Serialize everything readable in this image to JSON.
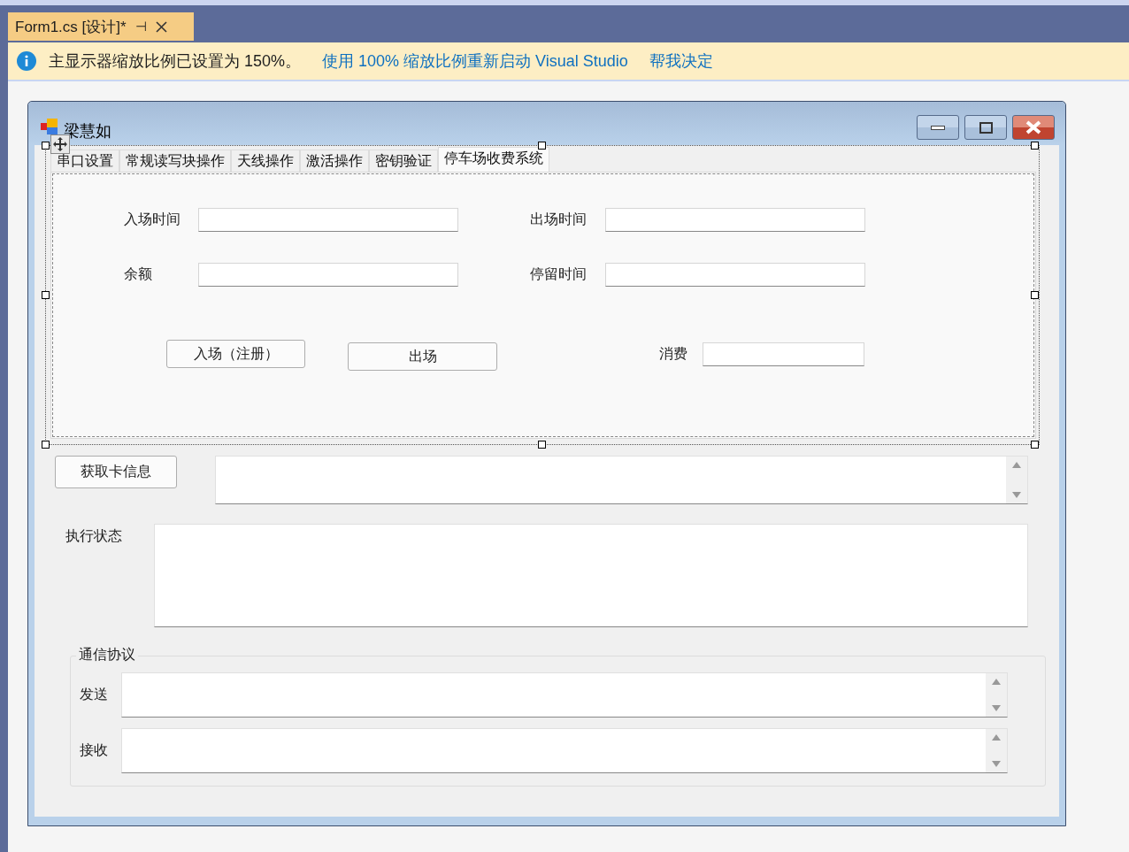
{
  "document_tab": {
    "title": "Form1.cs [设计]*",
    "pin": "⊣",
    "selected": true
  },
  "info_bar": {
    "message": "主显示器缩放比例已设置为 150%。",
    "links": [
      "使用 100% 缩放比例重新启动 Visual Studio",
      "帮我决定"
    ]
  },
  "form": {
    "title": "梁慧如"
  },
  "tabs": [
    {
      "label": "串口设置",
      "selected": false
    },
    {
      "label": "常规读写块操作",
      "selected": false
    },
    {
      "label": "天线操作",
      "selected": false
    },
    {
      "label": "激活操作",
      "selected": false
    },
    {
      "label": "密钥验证",
      "selected": false
    },
    {
      "label": "停车场收费系统",
      "selected": true
    }
  ],
  "parking": {
    "fields": [
      {
        "label": "入场时间"
      },
      {
        "label": "出场时间"
      },
      {
        "label": "余额"
      },
      {
        "label": "停留时间"
      }
    ],
    "buttons": [
      "入场（注册）",
      "出场"
    ],
    "fee": {
      "label": "消费"
    }
  },
  "card_button": "获取卡信息",
  "status": {
    "label": "执行状态"
  },
  "protocol": {
    "title": "通信协议",
    "rows": [
      {
        "label": "发送"
      },
      {
        "label": "接收"
      }
    ]
  }
}
